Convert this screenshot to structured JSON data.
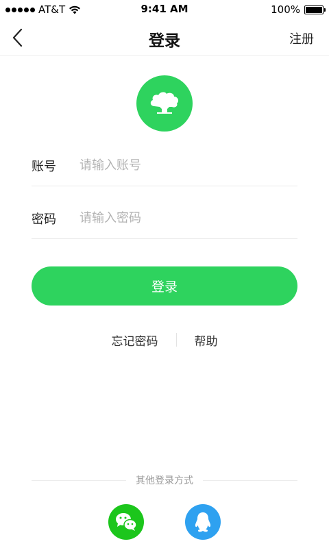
{
  "status_bar": {
    "carrier": "AT&T",
    "time": "9:41 AM",
    "battery": "100%"
  },
  "nav": {
    "title": "登录",
    "right_action": "注册",
    "back_icon": "chevron-left-icon"
  },
  "logo": {
    "icon": "tree-icon",
    "color": "#2ed35e"
  },
  "form": {
    "account": {
      "label": "账号",
      "placeholder": "请输入账号",
      "value": ""
    },
    "password": {
      "label": "密码",
      "placeholder": "请输入密码",
      "value": ""
    },
    "submit_label": "登录"
  },
  "links": {
    "forgot_password": "忘记密码",
    "help": "帮助"
  },
  "other_login": {
    "title": "其他登录方式",
    "providers": [
      {
        "icon": "wechat-icon",
        "color": "#1cc61c"
      },
      {
        "icon": "qq-icon",
        "color": "#2ea1f0"
      }
    ]
  },
  "colors": {
    "accent": "#2ed35e",
    "wechat": "#1cc61c",
    "qq": "#2ea1f0"
  }
}
